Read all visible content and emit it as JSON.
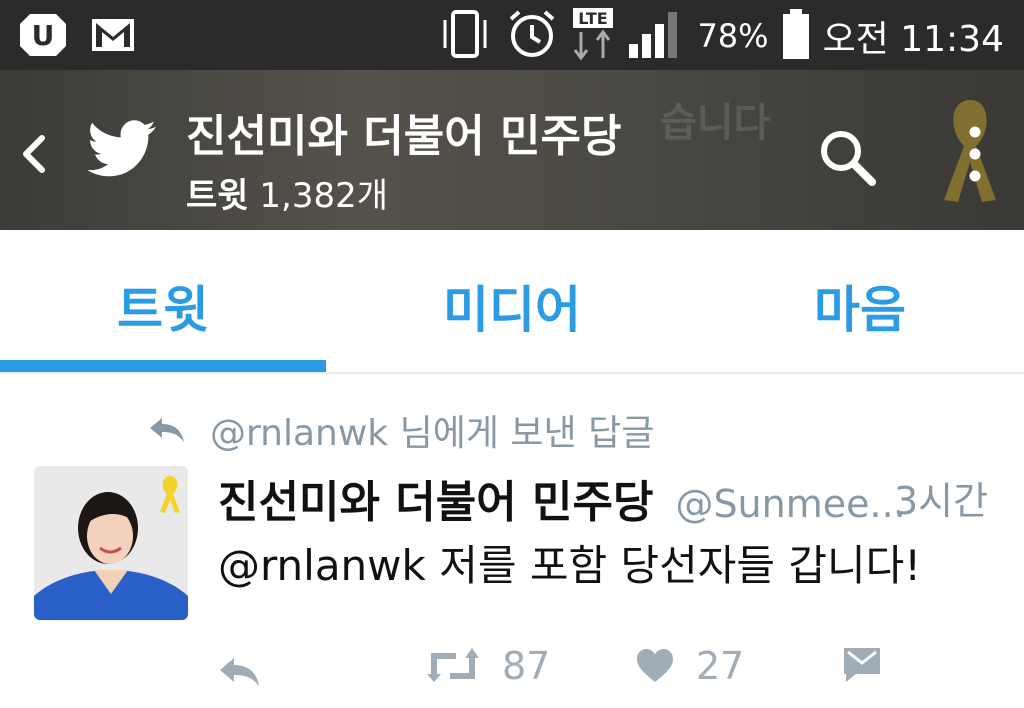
{
  "status_bar": {
    "battery_percent": "78%",
    "time": "오전 11:34",
    "network": "LTE",
    "icons": [
      "uplus-icon",
      "gmail-icon",
      "vibrate-icon",
      "alarm-icon",
      "lte-icon",
      "signal-icon",
      "battery-icon"
    ]
  },
  "header": {
    "title": "진선미와 더불어 민주당",
    "tweets_label": "트윗",
    "tweets_count": "1,382개",
    "background_text": "습니다"
  },
  "tabs": [
    {
      "label": "트윗",
      "active": true
    },
    {
      "label": "미디어",
      "active": false
    },
    {
      "label": "마음",
      "active": false
    }
  ],
  "tweet": {
    "reply_to": "@rnlanwk 님에게 보낸 답글",
    "name": "진선미와 더불어 민주당",
    "handle": "@Sunmee...",
    "time": "3시간",
    "mention": "@rnlanwk",
    "text": "저를 포함 당선자들 갑니다!",
    "retweets": "87",
    "likes": "27"
  },
  "colors": {
    "accent": "#2b9be3",
    "status_bar": "#2b2b2b",
    "muted": "#8899a6",
    "action_icons": "#a0acb6"
  }
}
